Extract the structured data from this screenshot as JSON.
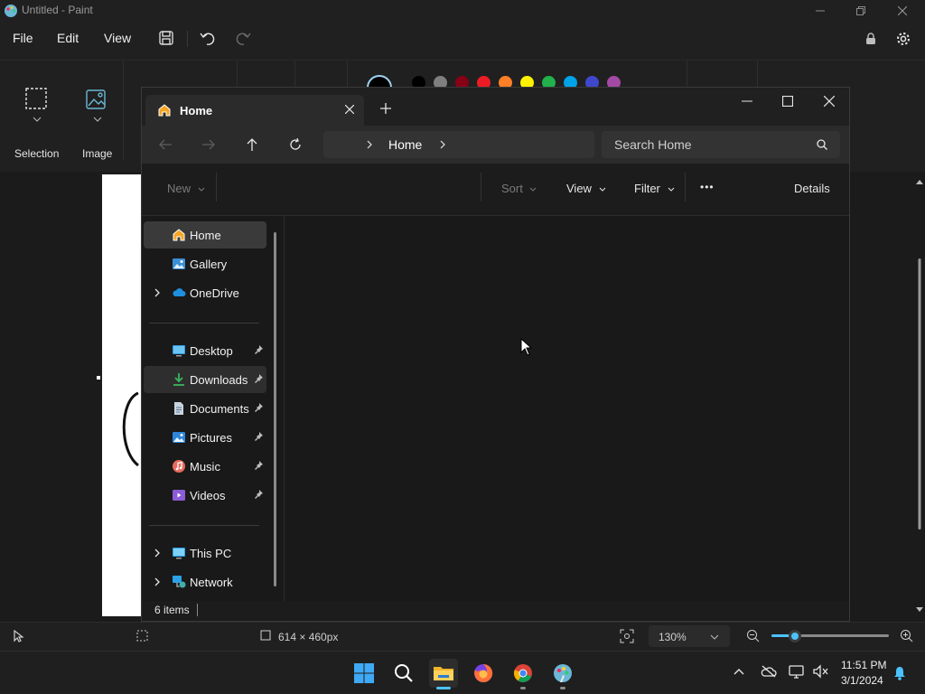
{
  "paint": {
    "title": "Untitled - Paint",
    "menu": {
      "file": "File",
      "edit": "Edit",
      "view": "View"
    },
    "toolbar": {
      "selection": "Selection",
      "image": "Image"
    },
    "colors": [
      "#000000",
      "#7f7f7f",
      "#880015",
      "#ed1c24",
      "#ff7f27",
      "#fff200",
      "#22b14c",
      "#00a2e8",
      "#3f48cc",
      "#a349a4"
    ],
    "status": {
      "canvas_size": "614 × 460px",
      "zoom": "130%"
    }
  },
  "explorer": {
    "tab_title": "Home",
    "address": {
      "crumb": "Home"
    },
    "search": {
      "placeholder": "Search Home"
    },
    "commands": {
      "new": "New",
      "sort": "Sort",
      "view": "View",
      "filter": "Filter",
      "more": "•••",
      "details": "Details"
    },
    "nav": {
      "home": "Home",
      "gallery": "Gallery",
      "onedrive": "OneDrive",
      "desktop": "Desktop",
      "downloads": "Downloads",
      "documents": "Documents",
      "pictures": "Pictures",
      "music": "Music",
      "videos": "Videos",
      "thispc": "This PC",
      "network": "Network"
    },
    "status": {
      "items": "6 items"
    }
  },
  "taskbar": {
    "clock": {
      "time": "11:51 PM",
      "date": "3/1/2024"
    }
  }
}
